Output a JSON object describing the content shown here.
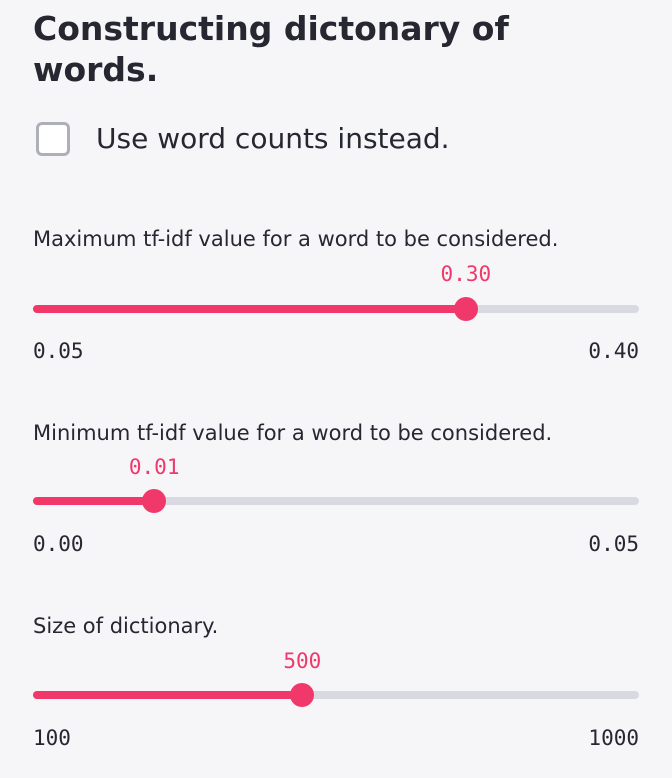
{
  "title": "Constructing dictonary of words.",
  "checkbox": {
    "label": "Use word counts instead.",
    "checked": false
  },
  "accent_color": "#f0386b",
  "sliders": [
    {
      "label": "Maximum tf-idf value for a word to be considered.",
      "value": "0.30",
      "min": "0.05",
      "max": "0.40",
      "numeric_value": 0.3,
      "numeric_min": 0.05,
      "numeric_max": 0.4
    },
    {
      "label": "Minimum tf-idf value for a word to be considered.",
      "value": "0.01",
      "min": "0.00",
      "max": "0.05",
      "numeric_value": 0.01,
      "numeric_min": 0.0,
      "numeric_max": 0.05
    },
    {
      "label": "Size of dictionary.",
      "value": "500",
      "min": "100",
      "max": "1000",
      "numeric_value": 500,
      "numeric_min": 100,
      "numeric_max": 1000
    }
  ]
}
